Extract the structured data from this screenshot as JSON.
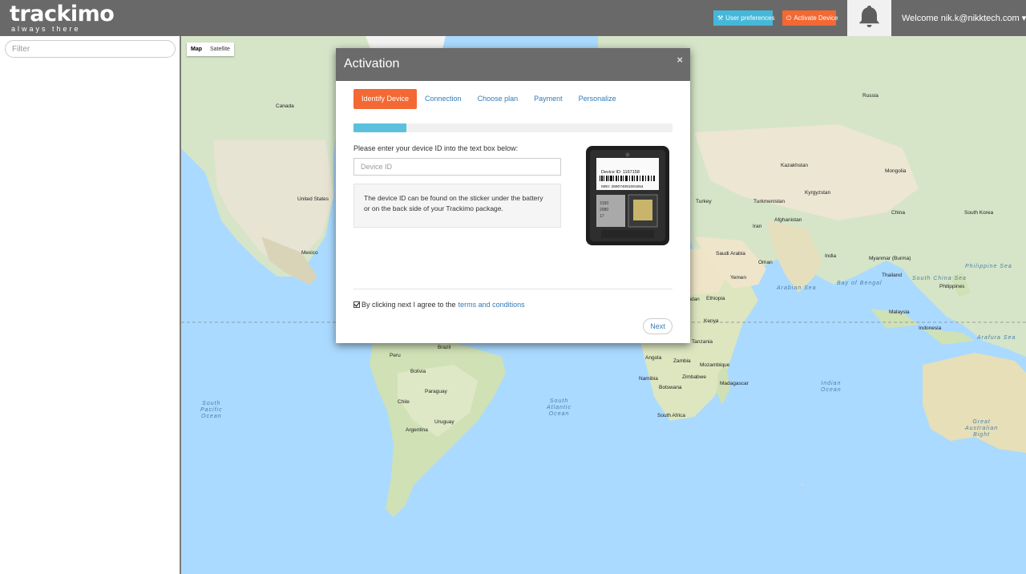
{
  "header": {
    "logo_text": "trackimo",
    "logo_tagline": "always there",
    "user_prefs_label": "User preferences",
    "activate_label": "Activate Device",
    "welcome_text": "Welcome nik.k@nikktech.com",
    "colors": {
      "bar": "#696969",
      "prefs": "#45b8d9",
      "activate": "#f46833"
    }
  },
  "sidebar": {
    "filter_placeholder": "Filter"
  },
  "map": {
    "type_options": [
      "Map",
      "Satellite"
    ],
    "selected_type": "Map",
    "labels": {
      "canada": "Canada",
      "united_states": "United States",
      "mexico": "Mexico",
      "russia": "Russia",
      "kazakhstan": "Kazakhstan",
      "mongolia": "Mongolia",
      "china": "China",
      "south_korea": "South Korea",
      "turkey": "Turkey",
      "turkmenistan": "Turkmenistan",
      "kyrgyzstan": "Kyrgyzstan",
      "afghanistan": "Afghanistan",
      "iran": "Iran",
      "india": "India",
      "saudi_arabia": "Saudi Arabia",
      "oman": "Oman",
      "yemen": "Yemen",
      "arabian_sea": "Arabian Sea",
      "bay_of_bengal": "Bay of Bengal",
      "myanmar": "Myanmar\n(Burma)",
      "thailand": "Thailand",
      "philippines": "Philippines",
      "philippine_sea": "Philippine Sea",
      "malaysia": "Malaysia",
      "indonesia": "Indonesia",
      "south_china_sea": "South China Sea",
      "sudan": "Sudan",
      "ethiopia": "Ethiopia",
      "kenya": "Kenya",
      "tanzania": "Tanzania",
      "angola": "Angola",
      "zambia": "Zambia",
      "zimbabwe": "Zimbabwe",
      "mozambique": "Mozambique",
      "namibia": "Namibia",
      "botswana": "Botswana",
      "madagascar": "Madagascar",
      "south_africa": "South Africa",
      "brazil": "Brazil",
      "peru": "Peru",
      "bolivia": "Bolivia",
      "paraguay": "Paraguay",
      "chile": "Chile",
      "argentina": "Argentina",
      "uruguay": "Uruguay",
      "south_pacific_ocean": "South\nPacific\nOcean",
      "south_atlantic_ocean": "South\nAtlantic\nOcean",
      "indian_ocean": "Indian\nOcean",
      "arafura_sea": "Arafura Sea",
      "great_australian_bight": "Great\nAustralian\nBight"
    }
  },
  "modal": {
    "title": "Activation",
    "close_glyph": "×",
    "tabs": [
      "Identify Device",
      "Connection",
      "Choose plan",
      "Payment",
      "Personalize"
    ],
    "active_tab": "Identify Device",
    "progress_fraction": 0.167,
    "prompt": "Please enter your device ID into the text box below:",
    "device_id_placeholder": "Device ID",
    "device_id_value": "",
    "info_text": "The device ID can be found on the sticker under the battery or on the back side of your Trackimo package.",
    "sticker": {
      "device_id": "Device ID: 1167158",
      "imei": "IMEI: 359074051061554",
      "sim_digits": [
        "3150",
        "2080",
        "17"
      ]
    },
    "agree_checked": true,
    "agree_text": "By clicking next I agree to the",
    "terms_link": "terms and conditions",
    "next_label": "Next"
  }
}
